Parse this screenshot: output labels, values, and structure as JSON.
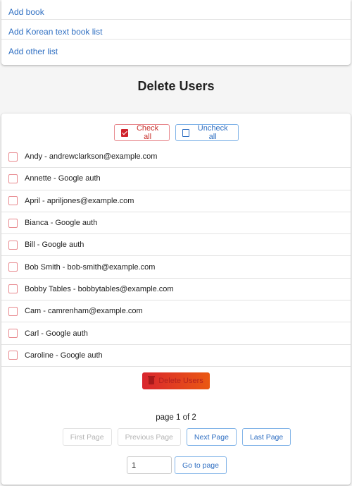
{
  "top_links": [
    {
      "label": "Add book"
    },
    {
      "label": "Add Korean text book list"
    },
    {
      "label": "Add other list"
    }
  ],
  "page_title": "Delete Users",
  "controls": {
    "check_all_label": "Check all",
    "uncheck_all_label": "Uncheck all"
  },
  "users": [
    {
      "label": "Andy - andrewclarkson@example.com",
      "checked": false
    },
    {
      "label": "Annette - Google auth",
      "checked": false
    },
    {
      "label": "April - apriljones@example.com",
      "checked": false
    },
    {
      "label": "Bianca - Google auth",
      "checked": false
    },
    {
      "label": "Bill - Google auth",
      "checked": false
    },
    {
      "label": "Bob Smith - bob-smith@example.com",
      "checked": false
    },
    {
      "label": "Bobby Tables - bobbytables@example.com",
      "checked": false
    },
    {
      "label": "Cam - camrenham@example.com",
      "checked": false
    },
    {
      "label": "Carl - Google auth",
      "checked": false
    },
    {
      "label": "Caroline - Google auth",
      "checked": false
    }
  ],
  "delete_button_label": "Delete Users",
  "pagination": {
    "info": "page 1 of 2",
    "current_page": 1,
    "total_pages": 2,
    "first_label": "First Page",
    "previous_label": "Previous Page",
    "next_label": "Next Page",
    "last_label": "Last Page",
    "goto_value": "1",
    "goto_label": "Go to page"
  },
  "colors": {
    "link": "#2f6fc2",
    "danger": "#d0222b",
    "delete_gradient_start": "#d9262e",
    "delete_gradient_end": "#ea5812"
  }
}
